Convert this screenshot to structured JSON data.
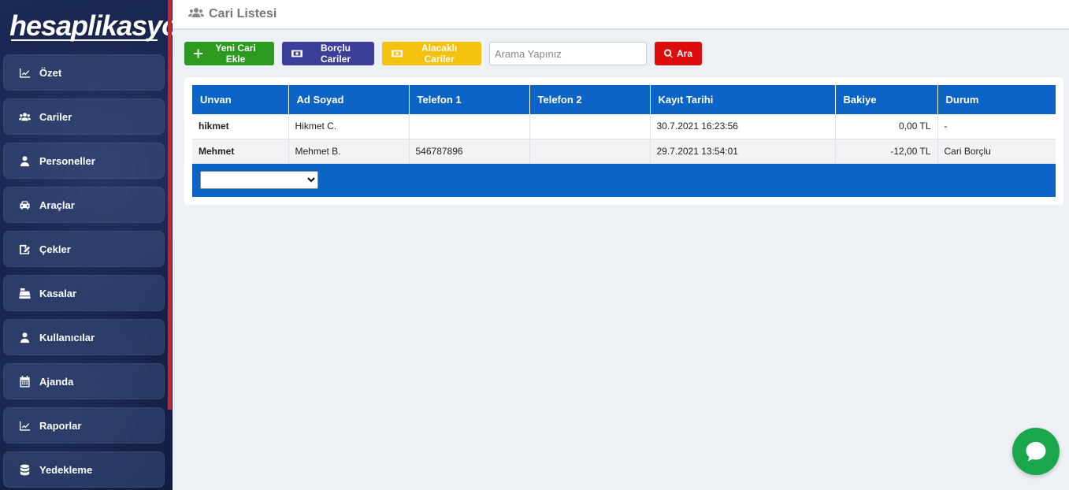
{
  "app": {
    "logo": "hesaplikasyon"
  },
  "sidebar": {
    "items": [
      {
        "label": "Özet",
        "icon": "chart-line-icon"
      },
      {
        "label": "Cariler",
        "icon": "users-icon"
      },
      {
        "label": "Personeller",
        "icon": "user-icon"
      },
      {
        "label": "Araçlar",
        "icon": "car-icon"
      },
      {
        "label": "Çekler",
        "icon": "signature-icon"
      },
      {
        "label": "Kasalar",
        "icon": "cash-register-icon"
      },
      {
        "label": "Kullanıcılar",
        "icon": "user-icon"
      },
      {
        "label": "Ajanda",
        "icon": "calendar-icon"
      },
      {
        "label": "Raporlar",
        "icon": "chart-line-icon"
      },
      {
        "label": "Yedekleme",
        "icon": "database-icon"
      }
    ]
  },
  "header": {
    "title": "Cari Listesi",
    "icon": "users-icon"
  },
  "toolbar": {
    "new_label": "Yeni Cari Ekle",
    "debtor_label": "Borçlu Cariler",
    "creditor_label": "Alacaklı Cariler",
    "search_placeholder": "Arama Yapınız",
    "search_value": "",
    "search_button_label": "Ara"
  },
  "table": {
    "columns": [
      "Unvan",
      "Ad Soyad",
      "Telefon 1",
      "Telefon 2",
      "Kayıt Tarihi",
      "Bakiye",
      "Durum"
    ],
    "rows": [
      {
        "unvan": "hikmet",
        "ad_soyad": "Hikmet C.",
        "telefon1": "",
        "telefon2": "",
        "kayit_tarihi": "30.7.2021 16:23:56",
        "bakiye": "0,00 TL",
        "durum": "-"
      },
      {
        "unvan": "Mehmet",
        "ad_soyad": "Mehmet B.",
        "telefon1": "546787896",
        "telefon2": "",
        "kayit_tarihi": "29.7.2021 13:54:01",
        "bakiye": "-12,00 TL",
        "durum": "Cari Borçlu"
      }
    ],
    "pager_selected": ""
  },
  "colors": {
    "sidebar_bg": "#14224a",
    "accent_red": "#d41f26",
    "table_header": "#0d64c7",
    "btn_green": "#2c9a1e",
    "btn_navy": "#3c3f99",
    "btn_yellow": "#f4c20d",
    "btn_red": "#dd0d0d",
    "chat_green": "#1aa64a"
  },
  "chat": {
    "icon": "chat-bubble-icon"
  }
}
